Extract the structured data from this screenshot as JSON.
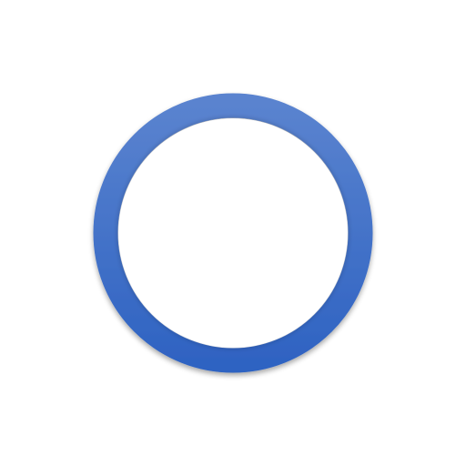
{
  "icon": {
    "name": "ring-icon",
    "shape": "circle-outline",
    "colors": {
      "stroke_light": "#5a83cf",
      "stroke_dark": "#2f63c2",
      "fill": "#ffffff",
      "background": "#ffffff"
    }
  }
}
